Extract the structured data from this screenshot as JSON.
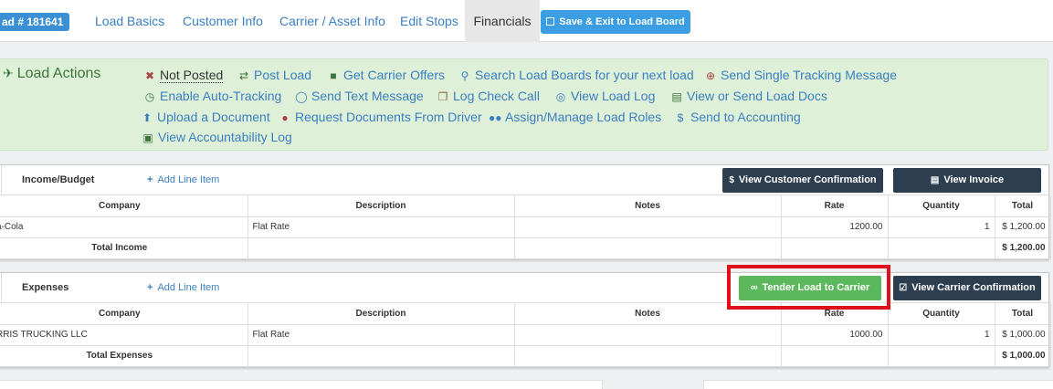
{
  "nav": {
    "load_badge": "ad # 181641",
    "tabs": [
      {
        "label": "Load Basics"
      },
      {
        "label": "Customer Info"
      },
      {
        "label": "Carrier / Asset Info"
      },
      {
        "label": "Edit Stops"
      },
      {
        "label": "Financials"
      }
    ],
    "save_label": "Save & Exit to Load Board"
  },
  "load_actions": {
    "title": "Load Actions",
    "items": [
      {
        "label": "Not Posted",
        "icon": "x-icon"
      },
      {
        "label": "Post Load",
        "icon": "retweet-icon"
      },
      {
        "label": "Get Carrier Offers",
        "icon": "truck-icon"
      },
      {
        "label": "Search Load Boards for your next load",
        "icon": "search-icon"
      },
      {
        "label": "Send Single Tracking Message",
        "icon": "crosshairs-icon"
      },
      {
        "label": "Enable Auto-Tracking",
        "icon": "clock-icon"
      },
      {
        "label": "Send Text Message",
        "icon": "comment-icon"
      },
      {
        "label": "Log Check Call",
        "icon": "copy-icon"
      },
      {
        "label": "View Load Log",
        "icon": "comments-icon"
      },
      {
        "label": "View or Send Load Docs",
        "icon": "file-icon"
      },
      {
        "label": "Upload a Document",
        "icon": "upload-icon"
      },
      {
        "label": "Request Documents From Driver",
        "icon": "user-icon"
      },
      {
        "label": "Assign/Manage Load Roles",
        "icon": "users-icon"
      },
      {
        "label": "Send to Accounting",
        "icon": "dollar-icon"
      },
      {
        "label": "View Accountability Log",
        "icon": "briefcase-icon"
      }
    ]
  },
  "income": {
    "title": "Income/Budget",
    "add_label": "Add Line Item",
    "btn_customer_conf": "View Customer Confirmation",
    "btn_invoice": "View Invoice",
    "columns": [
      "Company",
      "Description",
      "Notes",
      "Rate",
      "Quantity",
      "Total"
    ],
    "rows": [
      {
        "company": "a-Cola",
        "description": "Flat Rate",
        "notes": "",
        "rate": "1200.00",
        "quantity": "1",
        "total": "$ 1,200.00"
      }
    ],
    "total_label": "Total Income",
    "total_value": "$ 1,200.00"
  },
  "expenses": {
    "title": "Expenses",
    "add_label": "Add Line Item",
    "btn_tender": "Tender Load to Carrier",
    "btn_carrier_conf": "View Carrier Confirmation",
    "columns": [
      "Company",
      "Description",
      "Notes",
      "Rate",
      "Quantity",
      "Total"
    ],
    "rows": [
      {
        "company": "RRIS TRUCKING LLC",
        "description": "Flat Rate",
        "notes": "",
        "rate": "1000.00",
        "quantity": "1",
        "total": "$ 1,000.00"
      }
    ],
    "total_label": "Total Expenses",
    "total_value": "$ 1,000.00"
  },
  "colors": {
    "accent": "#3b8fd4",
    "actions_bg": "#dff0d8",
    "dark_button": "#2c3e50",
    "tender_button": "#5cb85c",
    "highlight": "#e0101b"
  }
}
